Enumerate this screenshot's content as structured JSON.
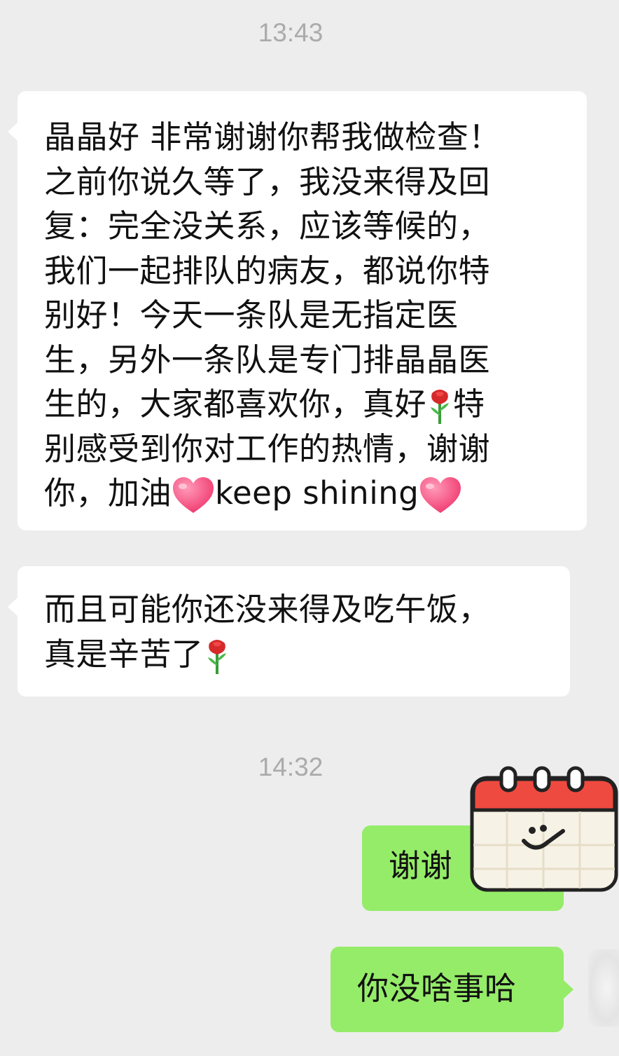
{
  "chat": {
    "timestamps": [
      "13:43",
      "14:32"
    ],
    "messages": [
      {
        "side": "left",
        "lines": [
          [
            "晶晶好 非常谢谢你帮我做检查！"
          ],
          [
            "之前你说久等了，我没来得及回"
          ],
          [
            "复：完全没关系，应该等候的，"
          ],
          [
            "我们一起排队的病友，都说你特"
          ],
          [
            "别好！今天一条队是无指定医"
          ],
          [
            "生，另外一条队是专门排晶晶医"
          ],
          [
            "生的，大家都喜欢你，真好",
            "rose-emoji",
            "特"
          ],
          [
            "别感受到你对工作的热情，谢谢"
          ],
          [
            "你，加油",
            "heart-emoji",
            "keep shining",
            "heart-emoji"
          ]
        ]
      },
      {
        "side": "left",
        "lines": [
          [
            "而且可能你还没来得及吃午饭，"
          ],
          [
            "真是辛苦了",
            "rose-emoji"
          ]
        ]
      },
      {
        "side": "right",
        "lines": [
          [
            "谢谢"
          ]
        ]
      },
      {
        "side": "right",
        "lines": [
          [
            "你没啥事哈"
          ]
        ]
      }
    ]
  },
  "colors": {
    "background": "#ededed",
    "left_bubble": "#ffffff",
    "right_bubble": "#95ec69",
    "timestamp": "#ababab",
    "text": "#111111"
  },
  "sticker": {
    "icon": "calendar-smile-sticker"
  }
}
